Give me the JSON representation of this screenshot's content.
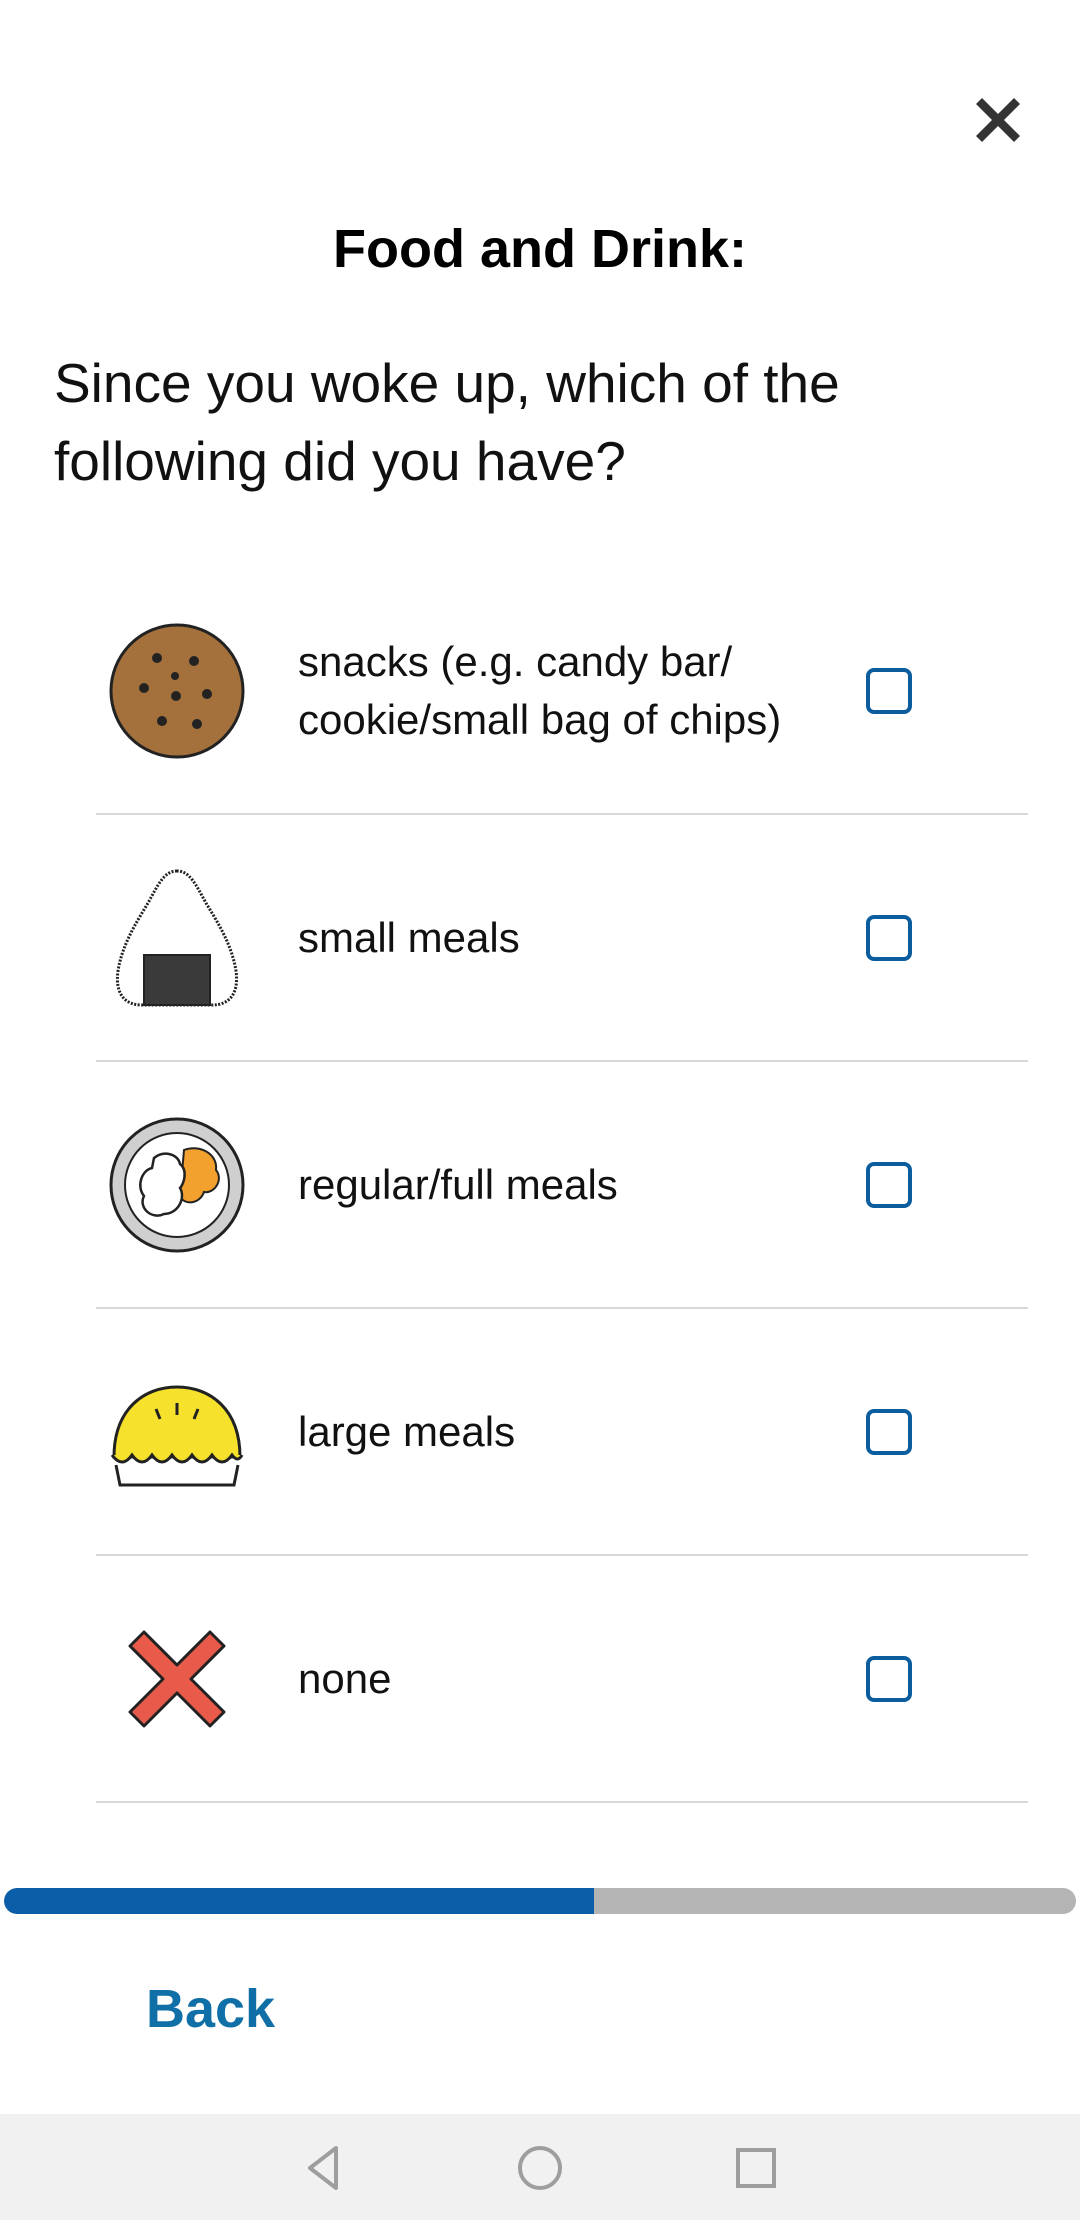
{
  "header": {
    "title": "Food and Drink:",
    "close_icon": "close-icon"
  },
  "question": "Since you woke up, which of the following did you have?",
  "options": [
    {
      "label": "snacks (e.g. candy bar/ cookie/small bag of chips)",
      "icon": "cookie-icon",
      "checked": false
    },
    {
      "label": "small meals",
      "icon": "rice-ball-icon",
      "checked": false
    },
    {
      "label": "regular/full meals",
      "icon": "plate-icon",
      "checked": false
    },
    {
      "label": "large meals",
      "icon": "pie-icon",
      "checked": false
    },
    {
      "label": "none",
      "icon": "red-x-icon",
      "checked": false
    }
  ],
  "progress": {
    "fraction": 0.55
  },
  "footer": {
    "back_label": "Back"
  },
  "colors": {
    "accent": "#0b5ea8",
    "checkbox_border": "#0b5d9d",
    "progress_track": "#b4b4b4",
    "back_text": "#0f6fa6"
  },
  "system_nav": {
    "back_icon": "nav-back-icon",
    "home_icon": "nav-home-icon",
    "recents_icon": "nav-recents-icon"
  }
}
